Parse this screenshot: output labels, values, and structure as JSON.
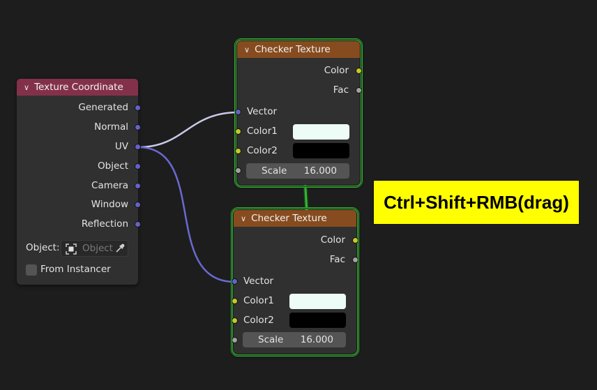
{
  "texture_coordinate": {
    "title": "Texture Coordinate",
    "outputs": [
      "Generated",
      "Normal",
      "UV",
      "Object",
      "Camera",
      "Window",
      "Reflection"
    ],
    "object_label": "Object:",
    "object_placeholder": "Object",
    "from_instancer_label": "From Instancer"
  },
  "checker_top": {
    "title": "Checker Texture",
    "out_color": "Color",
    "out_fac": "Fac",
    "in_vector": "Vector",
    "in_color1": "Color1",
    "in_color2": "Color2",
    "scale_label": "Scale",
    "scale_value": "16.000",
    "color1_hex": "#eefcf8",
    "color2_hex": "#000000"
  },
  "checker_bottom": {
    "title": "Checker Texture",
    "out_color": "Color",
    "out_fac": "Fac",
    "in_vector": "Vector",
    "in_color1": "Color1",
    "in_color2": "Color2",
    "scale_label": "Scale",
    "scale_value": "16.000",
    "color1_hex": "#eefcf8",
    "color2_hex": "#000000"
  },
  "hint": {
    "text": "Ctrl+Shift+RMB(drag)"
  },
  "colors": {
    "selection": "#3cb13c",
    "link_uv_top": "#c8c8e8",
    "link_uv_bottom": "#6a6ad0",
    "lazy_connect": "#3cb13c"
  }
}
